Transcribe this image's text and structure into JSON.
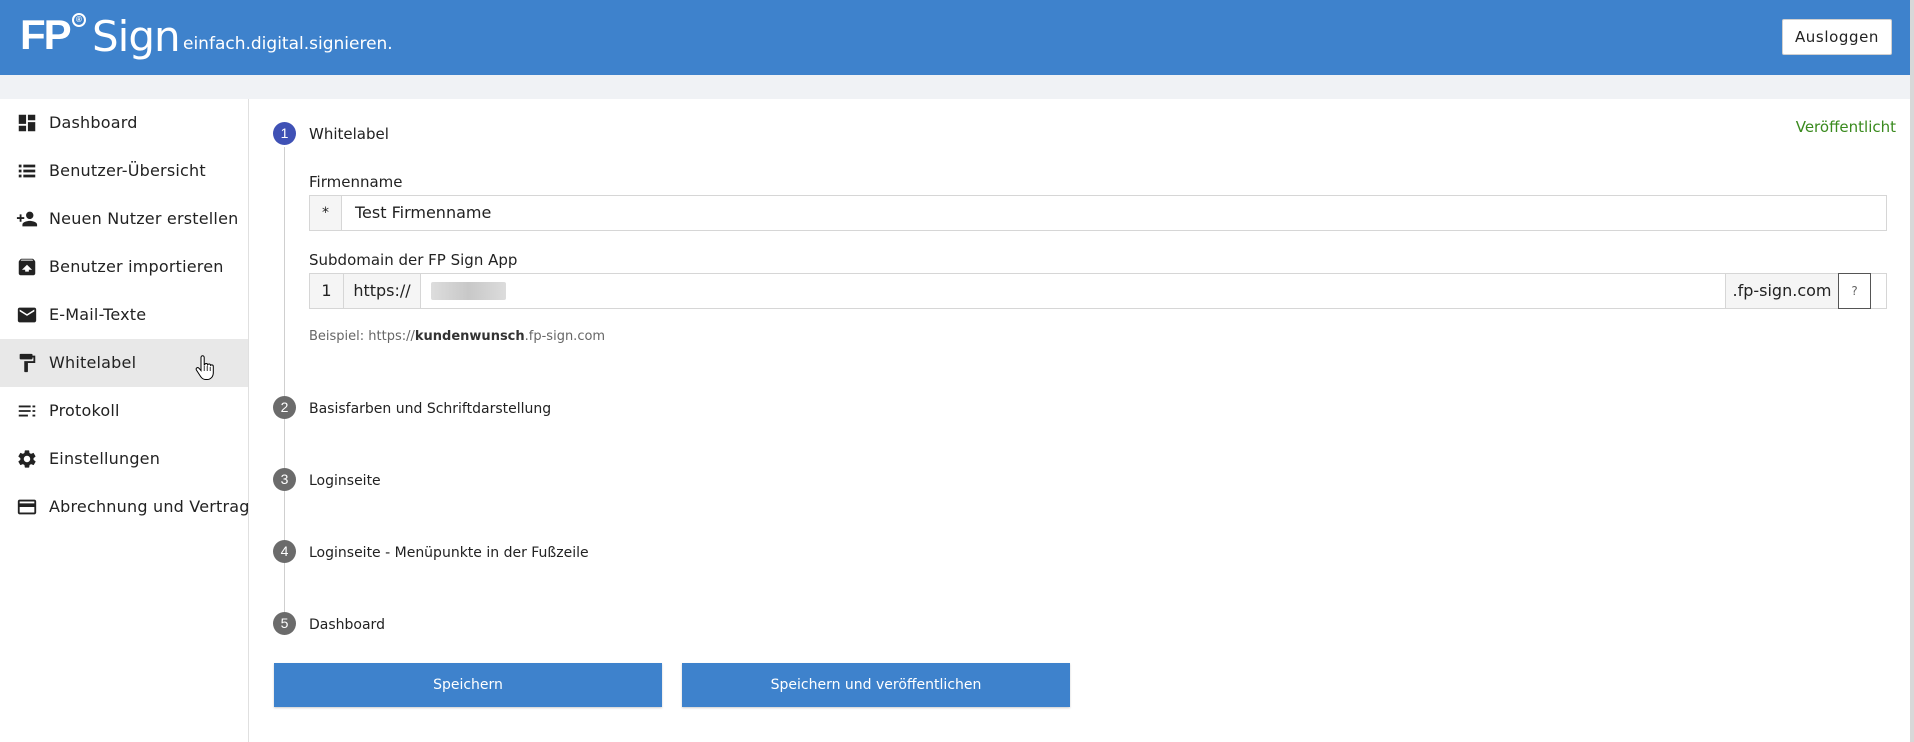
{
  "header": {
    "logo_fp": "FP",
    "logo_badge": "®",
    "logo_sign": "Sign",
    "tagline": "einfach.digital.signieren.",
    "logout_label": "Ausloggen",
    "brand_color": "#3e82cc"
  },
  "sidebar": {
    "items": [
      {
        "label": "Dashboard",
        "icon": "dashboard-icon"
      },
      {
        "label": "Benutzer-Übersicht",
        "icon": "list-icon"
      },
      {
        "label": "Neuen Nutzer erstellen",
        "icon": "person-add-icon"
      },
      {
        "label": "Benutzer importieren",
        "icon": "archive-icon"
      },
      {
        "label": "E-Mail-Texte",
        "icon": "mail-icon"
      },
      {
        "label": "Whitelabel",
        "icon": "paint-roller-icon",
        "active": true
      },
      {
        "label": "Protokoll",
        "icon": "notes-icon"
      },
      {
        "label": "Einstellungen",
        "icon": "gear-icon"
      },
      {
        "label": "Abrechnung und Vertrag",
        "icon": "credit-card-icon"
      }
    ]
  },
  "main": {
    "status": "Veröffentlicht",
    "status_color": "#3a8a1e",
    "steps": [
      {
        "number": "1",
        "label": "Whitelabel"
      },
      {
        "number": "2",
        "label": "Basisfarben und Schriftdarstellung"
      },
      {
        "number": "3",
        "label": "Loginseite"
      },
      {
        "number": "4",
        "label": "Loginseite - Menüpunkte in der Fußzeile"
      },
      {
        "number": "5",
        "label": "Dashboard"
      }
    ],
    "company": {
      "label": "Firmenname",
      "prefix": "*",
      "value": "Test Firmenname"
    },
    "subdomain": {
      "label": "Subdomain der FP Sign App",
      "prefix_number": "1",
      "protocol": "https://",
      "suffix": ".fp-sign.com",
      "help": "?"
    },
    "hint": {
      "prefix": "Beispiel: https://",
      "bold": "kundenwunsch",
      "suffix": ".fp-sign.com"
    },
    "buttons": {
      "save": "Speichern",
      "save_publish": "Speichern und veröffentlichen"
    }
  }
}
